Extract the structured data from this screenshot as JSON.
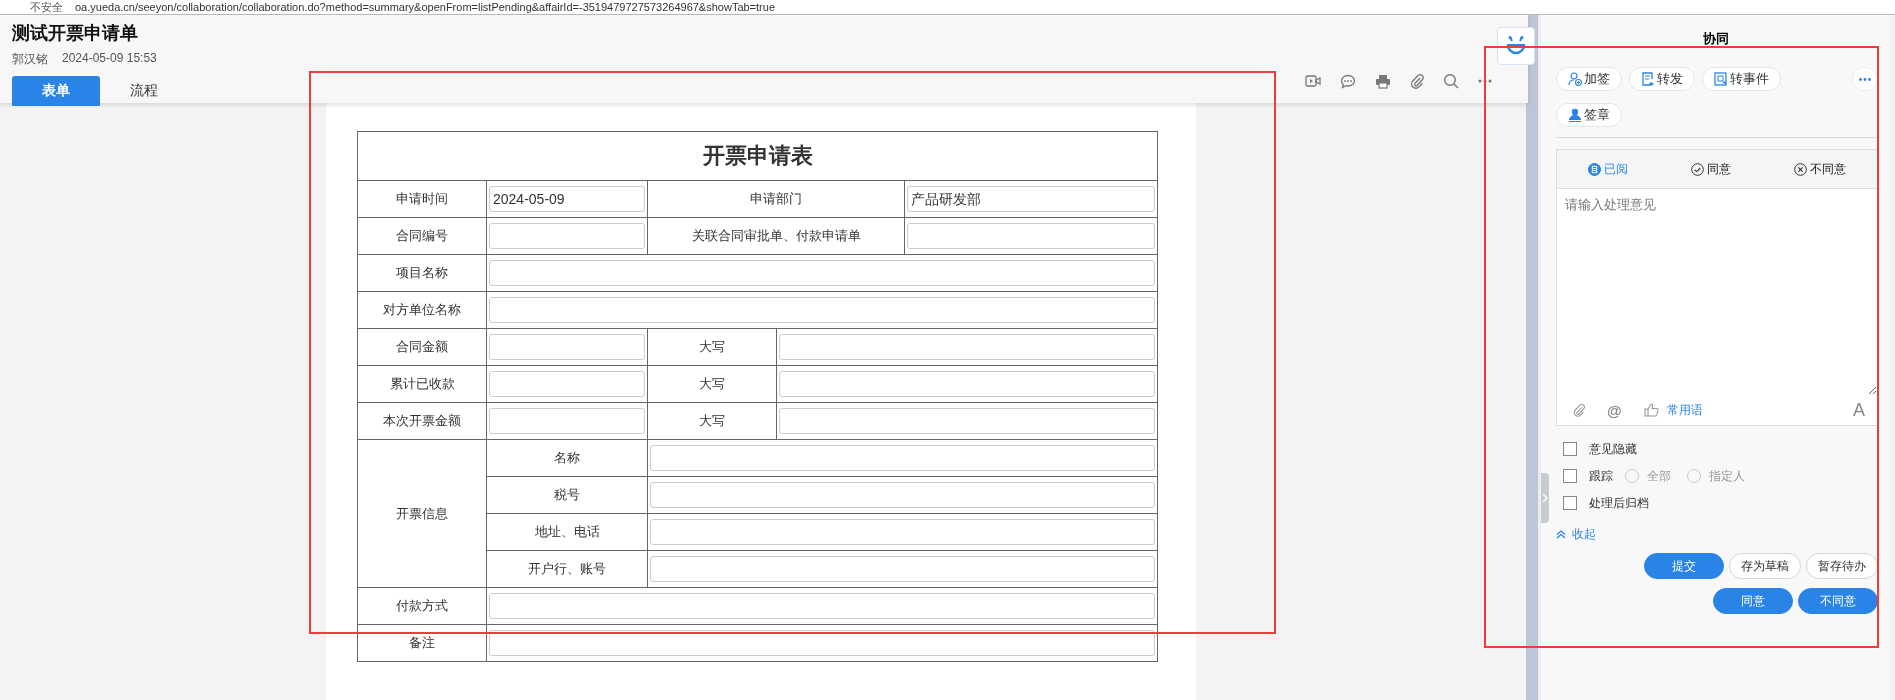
{
  "browser": {
    "security": "不安全",
    "url": "oa.yueda.cn/seeyon/collaboration/collaboration.do?method=summary&openFrom=listPending&affairId=-3519479727573264967&showTab=true"
  },
  "header": {
    "title": "测试开票申请单",
    "author": "郭汉铭",
    "time": "2024-05-09 15:53"
  },
  "tabs": [
    {
      "label": "表单",
      "selected": true
    },
    {
      "label": "流程",
      "selected": false
    }
  ],
  "form": {
    "title": "开票申请表",
    "rows": [
      {
        "kind": "pair",
        "label": "申请时间",
        "value": "2024-05-09",
        "label2": "申请部门",
        "value2": "产品研发部"
      },
      {
        "kind": "pair",
        "label": "合同编号",
        "label2": "关联合同审批单、付款申请单"
      },
      {
        "kind": "wide",
        "label": "项目名称"
      },
      {
        "kind": "wide",
        "label": "对方单位名称"
      },
      {
        "kind": "amount",
        "label": "合同金额",
        "label2": "大写"
      },
      {
        "kind": "amount",
        "label": "累计已收款",
        "label2": "大写"
      },
      {
        "kind": "amount",
        "label": "本次开票金额",
        "label2": "大写"
      },
      {
        "kind": "group",
        "label": "开票信息",
        "items": [
          {
            "label": "名称"
          },
          {
            "label": "税号"
          },
          {
            "label": "地址、电话"
          },
          {
            "label": "开户行、账号"
          }
        ]
      },
      {
        "kind": "wide",
        "label": "付款方式"
      },
      {
        "kind": "wide",
        "label": "备注"
      }
    ]
  },
  "panel": {
    "title": "协同",
    "actions": [
      {
        "kind": "add-signer",
        "label": "加签"
      },
      {
        "kind": "forward",
        "label": "转发"
      },
      {
        "kind": "event",
        "label": "转事件"
      },
      {
        "kind": "seal",
        "label": "签章"
      }
    ],
    "opinion": {
      "options": [
        {
          "kind": "read",
          "label": "已阅",
          "selected": true
        },
        {
          "kind": "agree",
          "label": "同意",
          "selected": false
        },
        {
          "kind": "disagree",
          "label": "不同意",
          "selected": false
        }
      ],
      "placeholder": "请输入处理意见",
      "mention": "@",
      "phrases": "常用语",
      "font": "A"
    },
    "settings": [
      {
        "label": "意见隐藏",
        "checked": false
      },
      {
        "label": "跟踪",
        "checked": false,
        "choices": [
          {
            "label": "全部",
            "selected": false
          },
          {
            "label": "指定人",
            "selected": false
          }
        ]
      },
      {
        "label": "处理后归档",
        "checked": false
      }
    ],
    "collapse": "收起",
    "buttons": [
      [
        {
          "label": "提交",
          "primary": true
        },
        {
          "label": "存为草稿",
          "primary": false
        },
        {
          "label": "暂存待办",
          "primary": false
        }
      ],
      [
        {
          "label": "同意",
          "primary": true
        },
        {
          "label": "不同意",
          "primary": true
        }
      ]
    ]
  }
}
